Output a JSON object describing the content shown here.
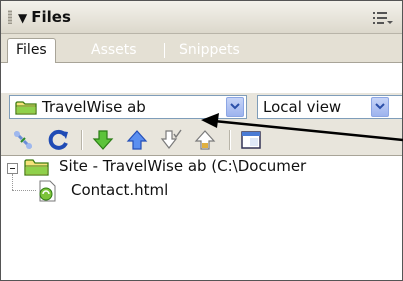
{
  "panel": {
    "title": "Files",
    "collapse_glyph": "▼",
    "options_icon": "panel-options-icon"
  },
  "tabs": [
    {
      "label": "Files",
      "active": true
    },
    {
      "label": "Assets",
      "active": false
    },
    {
      "label": "Snippets",
      "active": false
    }
  ],
  "site_selector": {
    "value": "TravelWise ab",
    "icon": "folder-icon"
  },
  "view_selector": {
    "value": "Local view"
  },
  "toolbar": {
    "icons": [
      "connect-icon",
      "refresh-icon",
      "get-files-icon",
      "put-files-icon",
      "check-out-icon",
      "check-in-icon",
      "expand-panel-icon"
    ]
  },
  "tree": {
    "site_label": "Site - TravelWise ab (C:\\Documer",
    "file_label": "Contact.html"
  },
  "colors": {
    "panel_bg": "#e8e5dc",
    "select_border": "#7f9db9",
    "dropdown_blue": "#9db3ee",
    "folder_green": "#5aa21c"
  }
}
